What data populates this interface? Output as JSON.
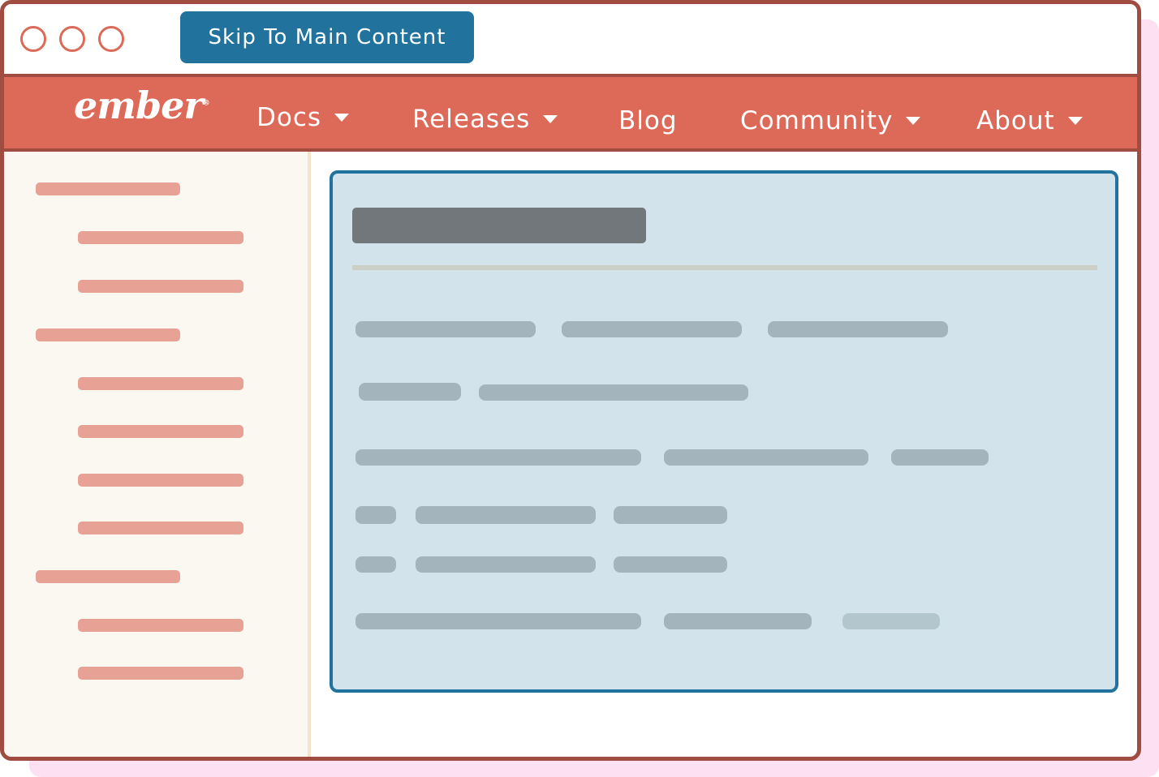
{
  "window": {
    "controls": [
      "close-dot",
      "minimize-dot",
      "maximize-dot"
    ],
    "skip_link_label": "Skip To Main Content"
  },
  "navbar": {
    "logo_text": "ember",
    "logo_mark": "®",
    "items": [
      {
        "label": "Docs",
        "has_dropdown": true
      },
      {
        "label": "Releases",
        "has_dropdown": true
      },
      {
        "label": "Blog",
        "has_dropdown": false
      },
      {
        "label": "Community",
        "has_dropdown": true
      },
      {
        "label": "About",
        "has_dropdown": true
      }
    ]
  },
  "colors": {
    "brand": "#dd6a58",
    "frame": "#a04c40",
    "focus": "#21739e",
    "content_bg": "#d3e3eb",
    "sidebar_bg": "#fbf7f1",
    "sidebar_placeholder": "#e7a295",
    "content_placeholder": "#a3b4bc",
    "shadow": "#fde0f2"
  },
  "sidebar": {
    "groups": [
      {
        "sub_items": 2
      },
      {
        "sub_items": 4
      },
      {
        "sub_items": 2
      }
    ]
  },
  "main": {
    "focused": true,
    "placeholder_rows": 6
  }
}
